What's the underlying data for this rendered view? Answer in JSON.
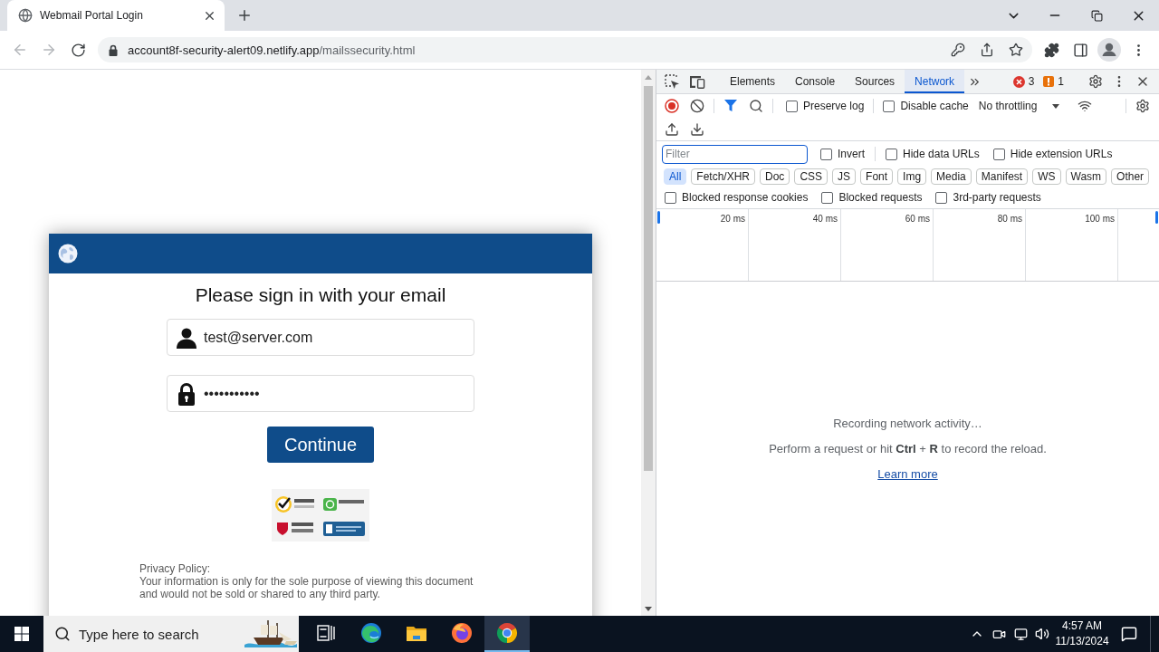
{
  "browser": {
    "tabs": [
      {
        "title": "Webmail Portal Login",
        "selected": true
      }
    ],
    "address": {
      "host": "account8f-security-alert09.netlify.app",
      "path": "/mailssecurity.html"
    }
  },
  "page": {
    "heading": "Please sign in with your email",
    "email": {
      "value": "test@server.com"
    },
    "password": {
      "value": "•••••••••••"
    },
    "button": "Continue",
    "privacy": {
      "title": "Privacy Policy:",
      "text": "Your information is only for the sole purpose of viewing this document\nand would not be sold or shared to any third party."
    }
  },
  "devtools": {
    "tabs": [
      {
        "label": "Elements",
        "selected": false
      },
      {
        "label": "Console",
        "selected": false
      },
      {
        "label": "Sources",
        "selected": false
      },
      {
        "label": "Network",
        "selected": true
      }
    ],
    "errors": "3",
    "warnings": "1",
    "recording": true,
    "options": [
      {
        "label": "Preserve log",
        "checked": false
      },
      {
        "label": "Disable cache",
        "checked": false
      }
    ],
    "throttling": "No throttling",
    "filter": {
      "placeholder": "Filter"
    },
    "filter_options": [
      {
        "label": "Invert",
        "checked": false
      },
      {
        "label": "Hide data URLs",
        "checked": false
      },
      {
        "label": "Hide extension URLs",
        "checked": false
      }
    ],
    "types": [
      {
        "label": "All",
        "selected": true
      },
      {
        "label": "Fetch/XHR",
        "selected": false
      },
      {
        "label": "Doc",
        "selected": false
      },
      {
        "label": "CSS",
        "selected": false
      },
      {
        "label": "JS",
        "selected": false
      },
      {
        "label": "Font",
        "selected": false
      },
      {
        "label": "Img",
        "selected": false
      },
      {
        "label": "Media",
        "selected": false
      },
      {
        "label": "Manifest",
        "selected": false
      },
      {
        "label": "WS",
        "selected": false
      },
      {
        "label": "Wasm",
        "selected": false
      },
      {
        "label": "Other",
        "selected": false
      }
    ],
    "blocked_options": [
      {
        "label": "Blocked response cookies",
        "checked": false
      },
      {
        "label": "Blocked requests",
        "checked": false
      },
      {
        "label": "3rd-party requests",
        "checked": false
      }
    ],
    "timeline": {
      "ticks": [
        "20 ms",
        "40 ms",
        "60 ms",
        "80 ms",
        "100 ms"
      ]
    },
    "empty": {
      "status": "Recording network activity…",
      "hint": "Perform a request or hit **Ctrl** + **R** to record the reload.",
      "link": "Learn more"
    }
  },
  "taskbar": {
    "search": {
      "placeholder": "Type here to search"
    },
    "apps": [
      {
        "kind": "task-view",
        "selected": false
      },
      {
        "kind": "edge",
        "selected": false
      },
      {
        "kind": "explorer",
        "selected": false
      },
      {
        "kind": "firefox",
        "selected": false
      },
      {
        "kind": "chrome",
        "selected": true
      }
    ],
    "time": "4:57 AM",
    "date": "11/13/2024"
  }
}
